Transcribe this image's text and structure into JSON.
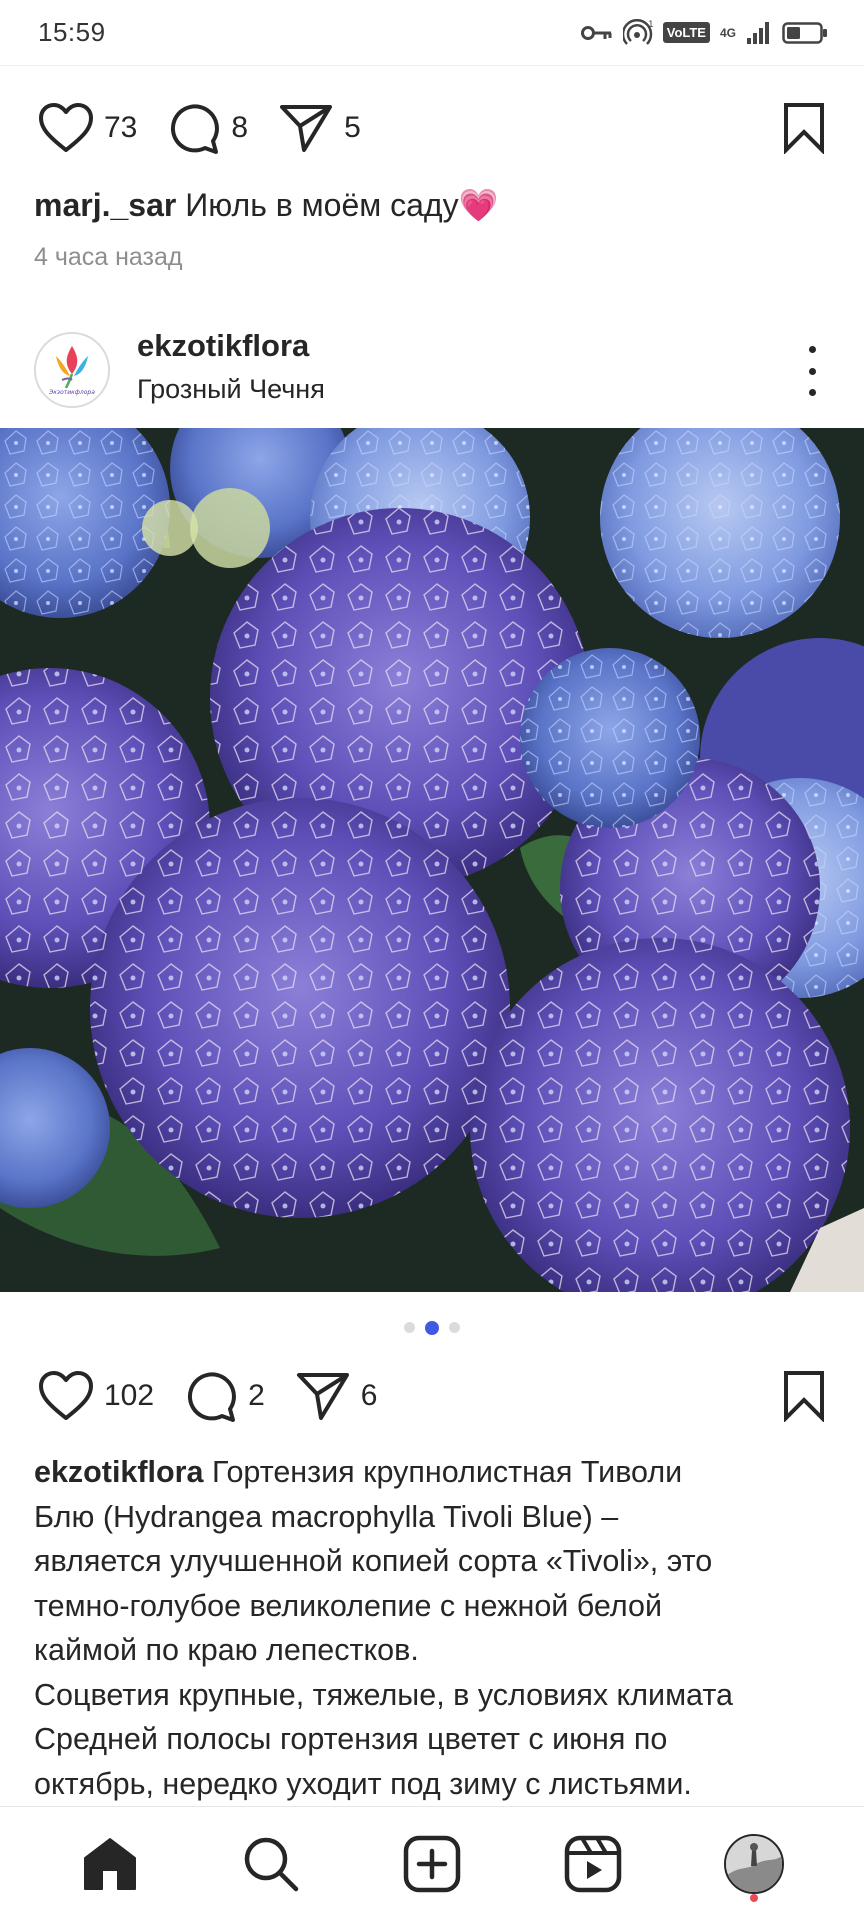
{
  "status_bar": {
    "time": "15:59",
    "volte": "VoLTE",
    "network": "4G",
    "icons": [
      "key-icon",
      "hotspot-icon",
      "volte-icon",
      "signal-icon",
      "battery-icon"
    ]
  },
  "post1": {
    "likes": "73",
    "comments": "8",
    "shares": "5",
    "username": "marj._sar",
    "caption": "Июль в моём саду💗",
    "time_ago": "4 часа назад"
  },
  "post2": {
    "username": "ekzotikflora",
    "location": "Грозный Чечня",
    "avatar_text": "Экзотикфлора",
    "likes": "102",
    "comments": "2",
    "shares": "6",
    "carousel": {
      "total": 3,
      "active_index": 1
    },
    "caption_lines": [
      "Гортензия крупнолистная Тиволи",
      "Блю (Hydrangea macrophylla Tivoli Blue) –",
      "является улучшенной копией сорта «Tivoli», это",
      "темно-голубое великолепие с нежной белой",
      "каймой по краю лепестков.",
      "Соцветия крупные, тяжелые, в условиях климата",
      "Средней полосы гортензия цветет с июня по",
      "октябрь, нередко уходит под зиму с листьями."
    ]
  },
  "bottom_nav": {
    "items": [
      "home-icon",
      "search-icon",
      "create-icon",
      "reels-icon",
      "profile-avatar"
    ],
    "active": "home-icon"
  },
  "colors": {
    "text": "#262626",
    "secondary": "#8e8e8e",
    "carousel_active": "#3f59e4",
    "notification": "#ed4956"
  }
}
